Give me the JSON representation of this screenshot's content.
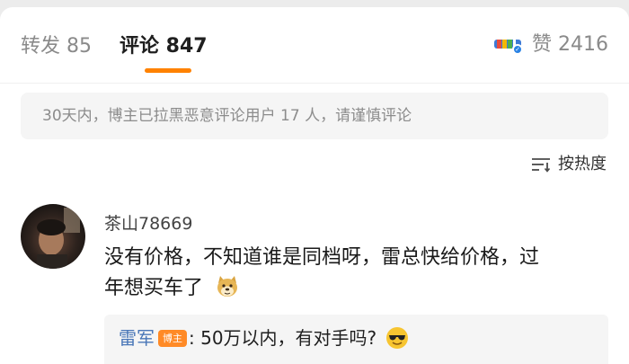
{
  "tabs": {
    "repost": "转发 85",
    "comments": "评论 847",
    "likes": "赞 2416"
  },
  "notice": "30天内，博主已拉黑恶意评论用户 17 人，请谨慎评论",
  "sort": {
    "label": "按热度",
    "icon": "sort-lines-icon"
  },
  "comment": {
    "username": "茶山78669",
    "text_line1": "没有价格，不知道谁是同档呀，雷总快给价格，过",
    "text_line2": "年想买车了",
    "emoji": "doge-emoji",
    "reply": {
      "author": "雷军",
      "badge": "博主",
      "text": ":  50万以内，有对手吗?",
      "emoji": "cool-sunglasses-emoji"
    }
  },
  "colors": {
    "accent": "#ff8200",
    "link_blue": "#4a77b8",
    "badge_orange": "#ff8a26"
  }
}
